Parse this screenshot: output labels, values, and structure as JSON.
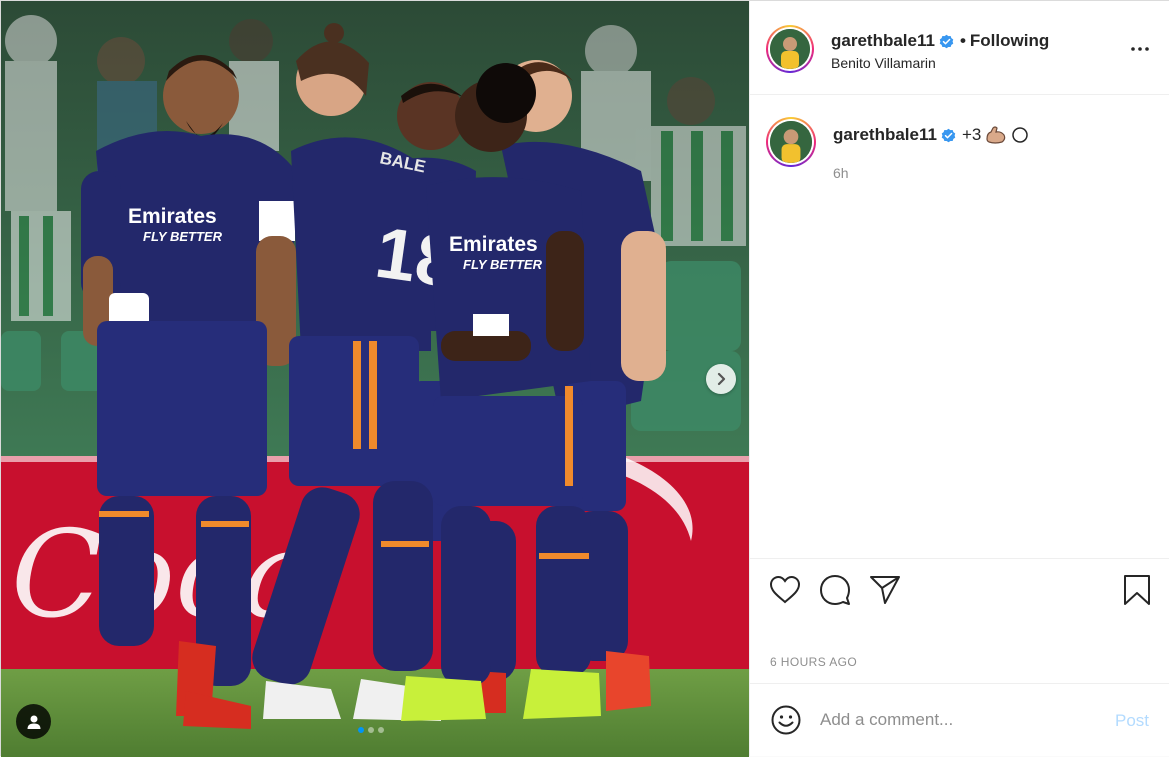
{
  "photo": {
    "alt": "Real Madrid players celebrating",
    "shirt_sponsor_1": "Emirates",
    "shirt_sponsor_2": "FLY BETTER",
    "shirt_sponsor_3": "Emirates",
    "shirt_sponsor_4": "FLY BETTER",
    "shirt_name": "BALE",
    "shirt_number": "18",
    "slide_count": 3,
    "active_slide": 1,
    "next_icon": "chevron-right-icon",
    "tag_icon": "user-tag-icon"
  },
  "header": {
    "username": "garethbale11",
    "dot": "•",
    "follow_status": "Following",
    "location": "Benito Villamarin",
    "more_icon": "more-horizontal-icon"
  },
  "caption": {
    "username": "garethbale11",
    "text": "+3",
    "emojis": [
      "flexed-biceps",
      "circle"
    ],
    "time": "6h"
  },
  "actions": {
    "like_icon": "heart-icon",
    "comment_icon": "comment-icon",
    "share_icon": "send-icon",
    "save_icon": "bookmark-icon"
  },
  "timestamp": "6 HOURS AGO",
  "comment": {
    "placeholder": "Add a comment...",
    "post_label": "Post",
    "emoji_icon": "smiley-icon"
  },
  "colors": {
    "accent": "#0095f6",
    "post_disabled": "#b3dbff",
    "secondary_text": "#8e8e8e",
    "kit": "#23286b"
  }
}
